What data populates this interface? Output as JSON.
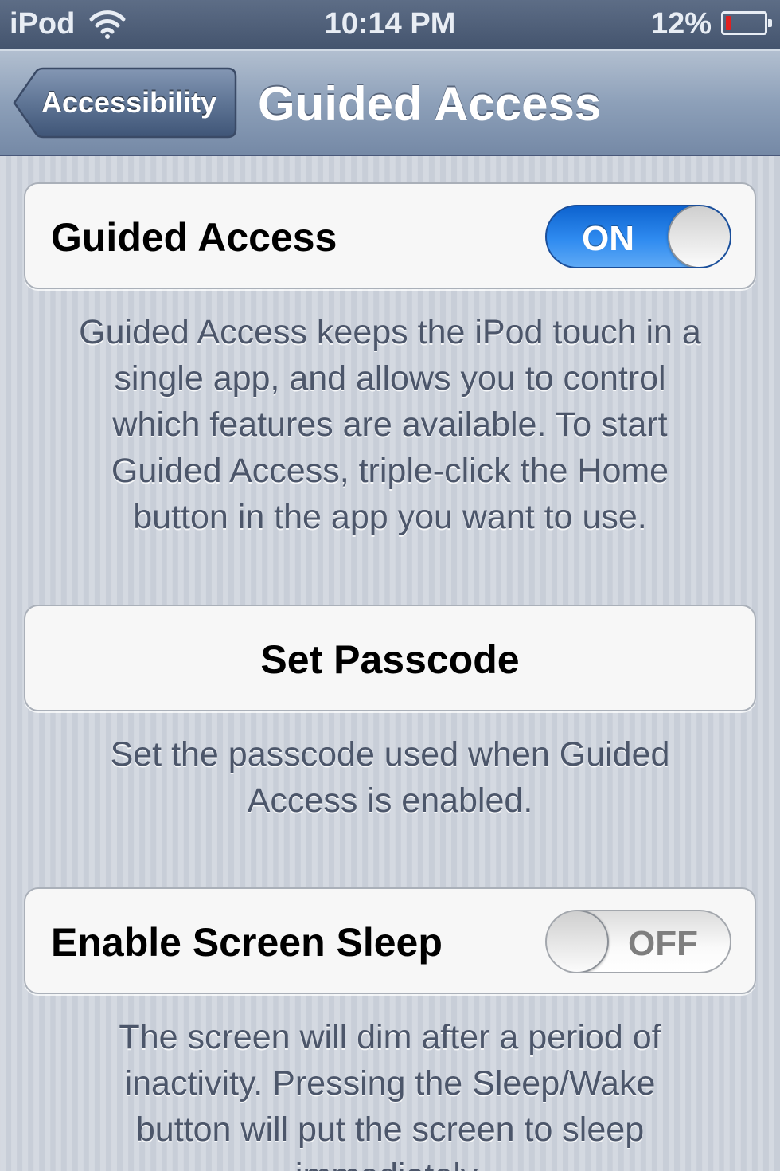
{
  "status_bar": {
    "carrier": "iPod",
    "time": "10:14 PM",
    "battery_percent": "12%",
    "battery_level": 0.12,
    "wifi_icon": "wifi-icon",
    "battery_icon": "battery-icon"
  },
  "nav_bar": {
    "back_label": "Accessibility",
    "title": "Guided Access"
  },
  "sections": {
    "guided_access": {
      "label": "Guided Access",
      "switch_text": "ON",
      "state": "on",
      "footer_lines": [
        "Guided Access keeps the iPod touch in a",
        "single app, and allows you to control",
        "which features are available. To start",
        "Guided Access, triple-click the Home",
        "button in the app you want to use."
      ]
    },
    "passcode": {
      "label": "Set Passcode",
      "footer_lines": [
        "Set the passcode used when Guided",
        "Access is enabled."
      ]
    },
    "screen_sleep": {
      "label": "Enable Screen Sleep",
      "switch_text": "OFF",
      "state": "off",
      "footer_lines": [
        "The screen will dim after a period of",
        "inactivity. Pressing the Sleep/Wake",
        "button will put the screen to sleep",
        "immediately."
      ]
    }
  },
  "colors": {
    "switch_on": "#2f8bf0",
    "nav_bar": "#8da0b9",
    "battery_low": "#e02020"
  }
}
